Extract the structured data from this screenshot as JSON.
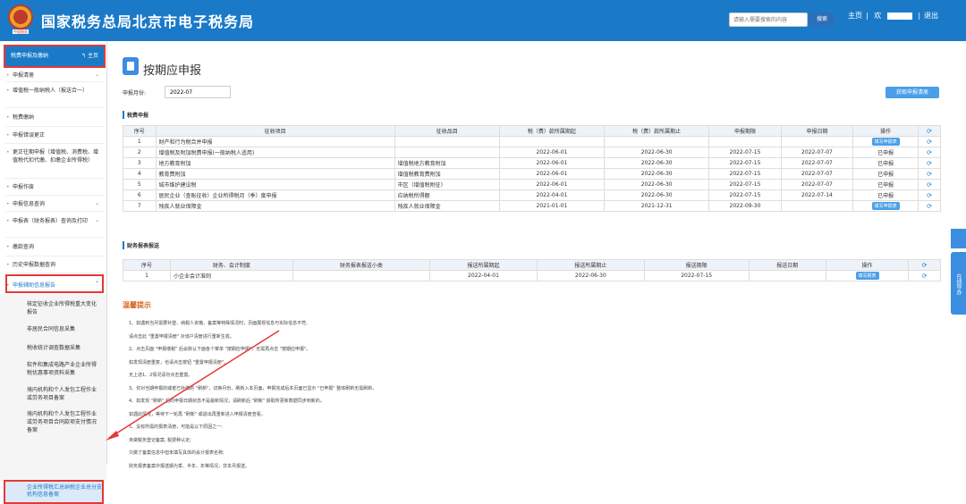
{
  "header": {
    "title": "国家税务总局北京市电子税务局",
    "logo_text": "中国税务",
    "search_placeholder": "请输入需要搜索的内容",
    "search_btn": "搜索",
    "home": "主页",
    "user": "欢",
    "logout": "退出"
  },
  "sidebar": {
    "top": "税费申报及缴纳",
    "top_home": "主页",
    "items": [
      "申报清册",
      "增值税一般纳税人（报送合一）",
      "税费缴纳",
      "申报错误更正",
      "更正往期申报（增值税、消费税、增值税代扣代缴、扣缴企业所得税）",
      "申报作废",
      "申报信息查询",
      "申报表（财务报表）查询及打印",
      "缴款查询",
      "历史申报数据查询",
      "申报辅助信息报告"
    ],
    "sub": [
      "核定征收企业所得税重大变化报告",
      "非居民合同信息采集",
      "税收统计调查数据采集",
      "软件和集成电路产业企业所得税优惠事项资料采集",
      "境内机构和个人发包工程作业或劳务项目备案",
      "境内机构和个人发包工程作业或劳务项目合同款项支付情况备案",
      "企业所得税汇总纳税企业总分支机构信息备案"
    ]
  },
  "main": {
    "title": "按期应申报",
    "month_label": "申报月份:",
    "month_value": "2022-07",
    "print_btn": "获取申报清册",
    "sec1": "税费申报",
    "t1_headers": [
      "序号",
      "征收项目",
      "征收品目",
      "税（费）款所属期起",
      "税（费）款所属期止",
      "申报期限",
      "申报日期",
      "操作"
    ],
    "t1_rows": [
      [
        "1",
        "财产和行为税合并申报",
        "",
        "",
        "",
        "",
        "",
        "填写申报表"
      ],
      [
        "2",
        "增值税及附加税费申报(一般纳税人适用)",
        "",
        "2022-06-01",
        "2022-06-30",
        "2022-07-15",
        "2022-07-07",
        "已申报"
      ],
      [
        "3",
        "地方教育附加",
        "增值税地方教育附加",
        "2022-06-01",
        "2022-06-30",
        "2022-07-15",
        "2022-07-07",
        "已申报"
      ],
      [
        "4",
        "教育费附加",
        "增值税教育费附加",
        "2022-06-01",
        "2022-06-30",
        "2022-07-15",
        "2022-07-07",
        "已申报"
      ],
      [
        "5",
        "城市维护建设税",
        "市区（增值税附征）",
        "2022-06-01",
        "2022-06-30",
        "2022-07-15",
        "2022-07-07",
        "已申报"
      ],
      [
        "6",
        "居民企业（查账征收）企业所得税月（季）度申报",
        "应纳税所得额",
        "2022-04-01",
        "2022-06-30",
        "2022-07-15",
        "2022-07-14",
        "已申报"
      ],
      [
        "7",
        "残疾人就业保障金",
        "残疾人就业保障金",
        "2021-01-01",
        "2021-12-31",
        "2022-09-30",
        "",
        "填写申报表"
      ]
    ],
    "sec2": "财务报表报送",
    "t2_headers": [
      "序号",
      "财务、会计制度",
      "财务报表报送小类",
      "报送所属期起",
      "报送所属期止",
      "报送期限",
      "报送日期",
      "操作"
    ],
    "t2_rows": [
      [
        "1",
        "小企业会计准则",
        "",
        "2022-04-01",
        "2022-06-30",
        "2022-07-15",
        "",
        "填写报表"
      ]
    ],
    "tips_title": "温馨提示",
    "tips": [
      "1、如遇到当月需要补登、纳税人资格、备案等特殊情况时，页面展现信息与实际信息不符,",
      "请点击此 \"重置申报清册\" 对该户清册进行重新生成。",
      "2、点击页面 \"申报缴税\" 后会默认下面各个菜单 \"按期应申报\"，无需再点击 \"按期应申报\"。",
      "如发现清册重复，也请点击按钮 \"重置申报清册\"。",
      "无上述1、2情况请勿点击重置。",
      "3、仅对当期申报的或者已补缴的 \"刷新\"，切换月份、刷新入本页面，申报完成后本页面已显示 \"已申报\" 整体刷新无需刷新。",
      "4、如发现 \"刷新\" 后的申报日期状态不是最新情况，请刷新后 \"刷新\" 获取所更新数据同步到新的。",
      "如遇此情况，等待下一轮再 \"刷新\" 或退出再重新进入申报清册查看。",
      "5、没有所需的报表清册，可能是以下原因之一:",
      "未做税务登记备案, 税费种认定;",
      "只做了备案信息中但未填写具体的会计报表名称;",
      "财务报表备案中报送期为季、半年、年等情况，非本月报送。"
    ]
  },
  "float": {
    "label": "在线导办"
  },
  "colors": {
    "header": "#1b7ac8",
    "accent": "#4a9fe8",
    "highlight": "#e53935"
  }
}
